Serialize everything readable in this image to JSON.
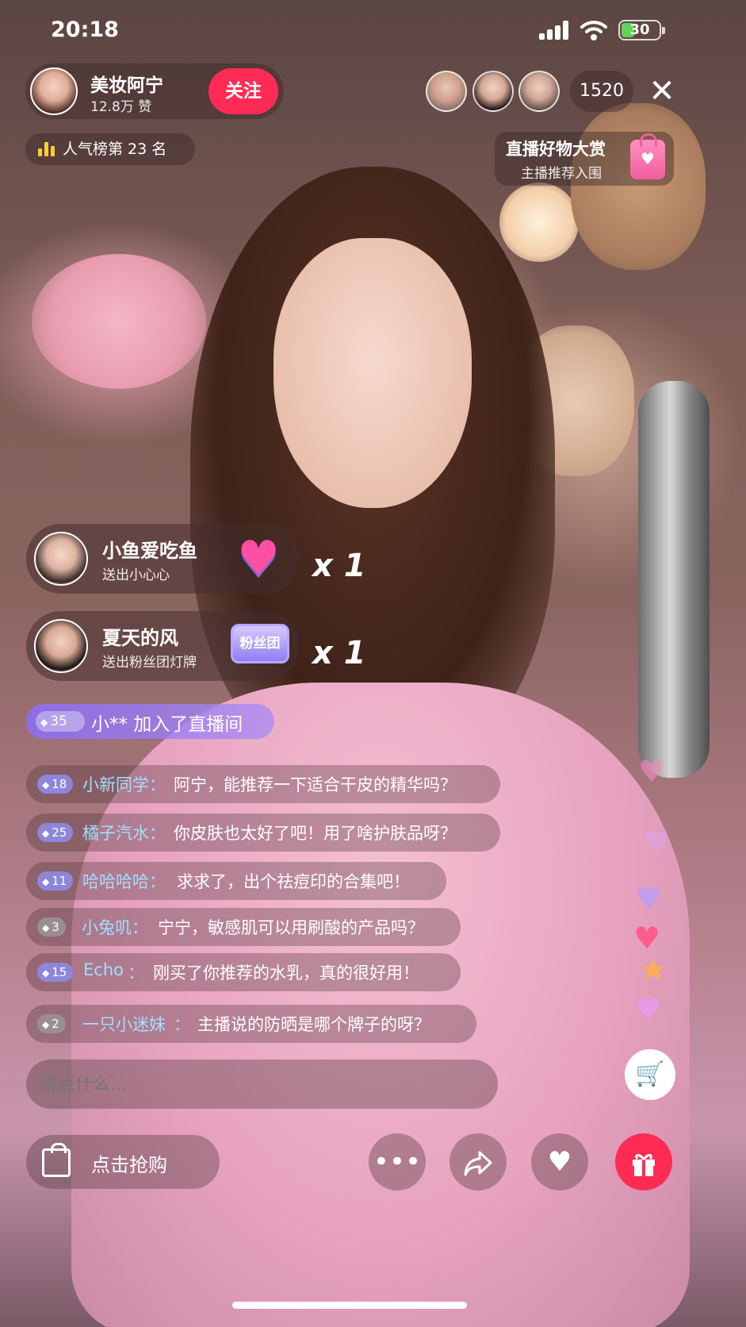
{
  "status_bar": {
    "time": "20:18",
    "battery": "30"
  },
  "host": {
    "name": "美妆阿宁",
    "likes": "12.8万 赞",
    "follow_label": "关注"
  },
  "viewers": {
    "count": "1520"
  },
  "ranking": {
    "label": "人气榜第 23 名"
  },
  "promo": {
    "title": "直播好物大赏",
    "subtitle": "主播推荐入围"
  },
  "gifts": [
    {
      "user": "小鱼爱吃鱼",
      "action": "送出小心心",
      "count": "x 1"
    },
    {
      "user": "夏天的风",
      "action": "送出粉丝团灯牌",
      "badge_text": "粉丝团",
      "count": "x 1"
    }
  ],
  "join_notice": {
    "level": "35",
    "text": "小** 加入了直播间"
  },
  "chat": [
    {
      "level": "18",
      "user": "小新同学",
      "sep": "：",
      "message": "阿宁，能推荐一下适合干皮的精华吗？"
    },
    {
      "level": "25",
      "user": "橘子汽水",
      "sep": "：",
      "message": "你皮肤也太好了吧！用了啥护肤品呀？"
    },
    {
      "level": "11",
      "user": "哈哈哈哈",
      "sep": "：",
      "message": "求求了，出个祛痘印的合集吧！"
    },
    {
      "level": "3",
      "user": "小兔叽",
      "sep": "：",
      "message": "宁宁，敏感肌可以用刷酸的产品吗？"
    },
    {
      "level": "15",
      "user": "Echo",
      "sep": "：",
      "message": "刚买了你推荐的水乳，真的很好用！"
    },
    {
      "level": "2",
      "user": "一只小迷妹",
      "sep": "：",
      "message": "主播说的防晒是哪个牌子的呀？"
    }
  ],
  "comment_input": {
    "placeholder": "说点什么..."
  },
  "bottom_bar": {
    "shop_label": "点击抢购"
  },
  "colors": {
    "accent": "#fe2c55",
    "username": "#9fe0ff",
    "join": "#8c6ef0",
    "input_placeholder": "#ffb25c"
  },
  "icons": [
    "signal-icon",
    "wifi-icon",
    "battery-icon",
    "close-icon",
    "rank-icon",
    "shopping-bag-icon",
    "heart-gift-icon",
    "fan-badge-icon",
    "cart-icon",
    "more-icon",
    "share-icon",
    "like-icon",
    "gift-icon"
  ]
}
